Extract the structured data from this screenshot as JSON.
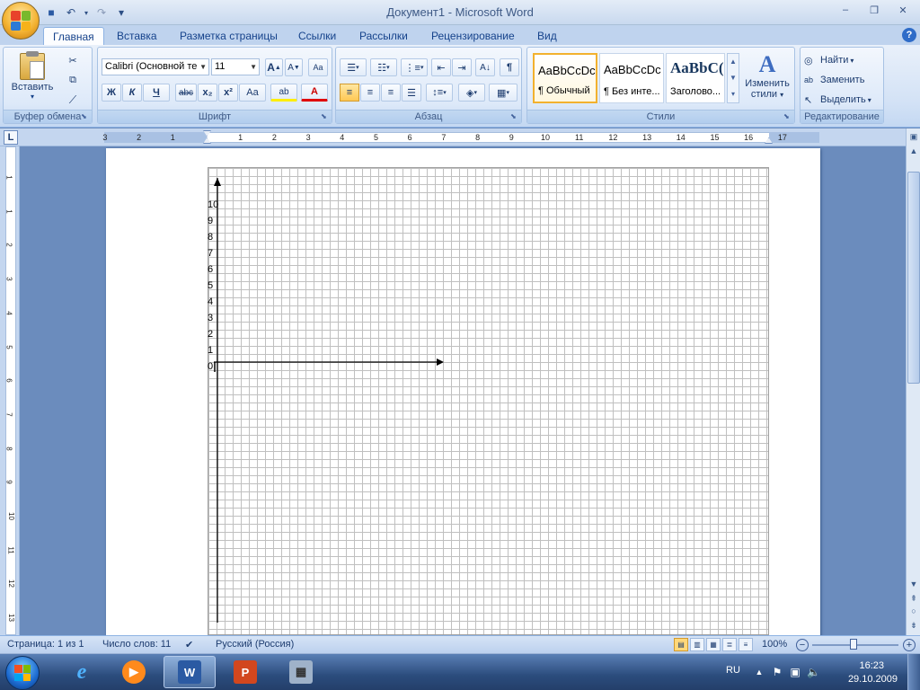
{
  "window": {
    "title": "Документ1 - Microsoft Word",
    "controls": {
      "minimize": "–",
      "maximize": "❐",
      "close": "✕"
    }
  },
  "quick_access": {
    "save": "💾",
    "undo": "↶",
    "redo": "↷",
    "customize": "▾"
  },
  "tabs": [
    {
      "label": "Главная",
      "active": true
    },
    {
      "label": "Вставка"
    },
    {
      "label": "Разметка страницы"
    },
    {
      "label": "Ссылки"
    },
    {
      "label": "Рассылки"
    },
    {
      "label": "Рецензирование"
    },
    {
      "label": "Вид"
    }
  ],
  "help": "?",
  "ribbon": {
    "clipboard": {
      "title": "Буфер обмена",
      "paste": "Вставить",
      "cut_icon": "✂",
      "copy_icon": "⧉",
      "format_painter_icon": "🖌"
    },
    "font": {
      "title": "Шрифт",
      "font_name": "Calibri (Основной те",
      "font_size": "11",
      "grow": "A",
      "shrink": "A",
      "clear": "Aa",
      "bold": "Ж",
      "italic": "К",
      "underline": "Ч",
      "strike": "abc",
      "subscript": "x₂",
      "superscript": "x²",
      "case": "Aa",
      "highlight": "ab",
      "font_color": "A"
    },
    "paragraph": {
      "title": "Абзац",
      "pilcrow": "¶"
    },
    "styles": {
      "title": "Стили",
      "items": [
        {
          "sample": "AaBbCcDc",
          "name": "¶ Обычный",
          "active": true
        },
        {
          "sample": "AaBbCcDc",
          "name": "¶ Без инте..."
        },
        {
          "sample": "AaBbC(",
          "name": "Заголово..."
        }
      ],
      "change_styles": "Изменить",
      "change_styles2": "стили"
    },
    "editing": {
      "title": "Редактирование",
      "find": "Найти",
      "replace": "Заменить",
      "select": "Выделить"
    }
  },
  "ruler": {
    "toggle": "L",
    "numbers": [
      "3",
      "2",
      "1",
      "1",
      "2",
      "3",
      "4",
      "5",
      "6",
      "7",
      "8",
      "9",
      "10",
      "11",
      "12",
      "13",
      "14",
      "15",
      "16",
      "17"
    ],
    "vnumbers": [
      "1",
      "1",
      "2",
      "3",
      "4",
      "5",
      "6",
      "7",
      "8",
      "9",
      "10",
      "11",
      "12",
      "13"
    ]
  },
  "document": {
    "y_labels": [
      "10",
      "9",
      "8",
      "7",
      "6",
      "5",
      "4",
      "3",
      "2",
      "1",
      "0"
    ]
  },
  "status": {
    "page": "Страница: 1 из 1",
    "words": "Число слов: 11",
    "language": "Русский (Россия)",
    "zoom": "100%"
  },
  "taskbar": {
    "language": "RU",
    "time": "16:23",
    "date": "29.10.2009"
  },
  "colors": {
    "accent": "#15428b",
    "ribbon_blue": "#bfd3ee",
    "workspace": "#6b8cbd",
    "style_highlight": "#f2b12e"
  }
}
